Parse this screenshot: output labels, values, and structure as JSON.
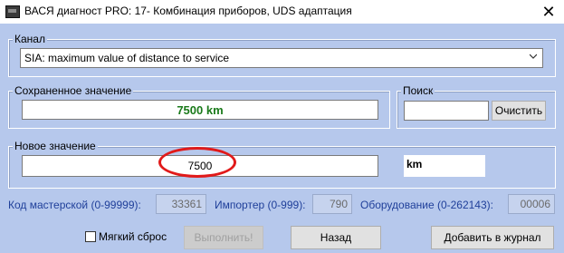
{
  "window": {
    "title": "ВАСЯ диагност PRO: 17- Комбинация приборов,  UDS адаптация",
    "close_glyph": "✕"
  },
  "channel": {
    "label": "Канал",
    "selected": "SIA: maximum value of distance to service"
  },
  "saved": {
    "label": "Сохраненное значение",
    "value": "7500 km"
  },
  "search": {
    "label": "Поиск",
    "input_value": "",
    "clear_label": "Очистить"
  },
  "new_value": {
    "label": "Новое значение",
    "value": "7500",
    "unit": "km"
  },
  "codes": {
    "workshop_label": "Код мастерской (0-99999):",
    "workshop_value": "33361",
    "importer_label": "Импортер (0-999):",
    "importer_value": "790",
    "equipment_label": "Оборудование (0-262143):",
    "equipment_value": "00006"
  },
  "footer": {
    "soft_reset_label": "Мягкий сброс",
    "soft_reset_checked": false,
    "execute_label": "Выполнить!",
    "back_label": "Назад",
    "add_log_label": "Добавить в журнал"
  },
  "colors": {
    "saved_value": "#1a7a1a",
    "highlight_ellipse": "#e11a1a",
    "background": "#b6c8ec"
  }
}
